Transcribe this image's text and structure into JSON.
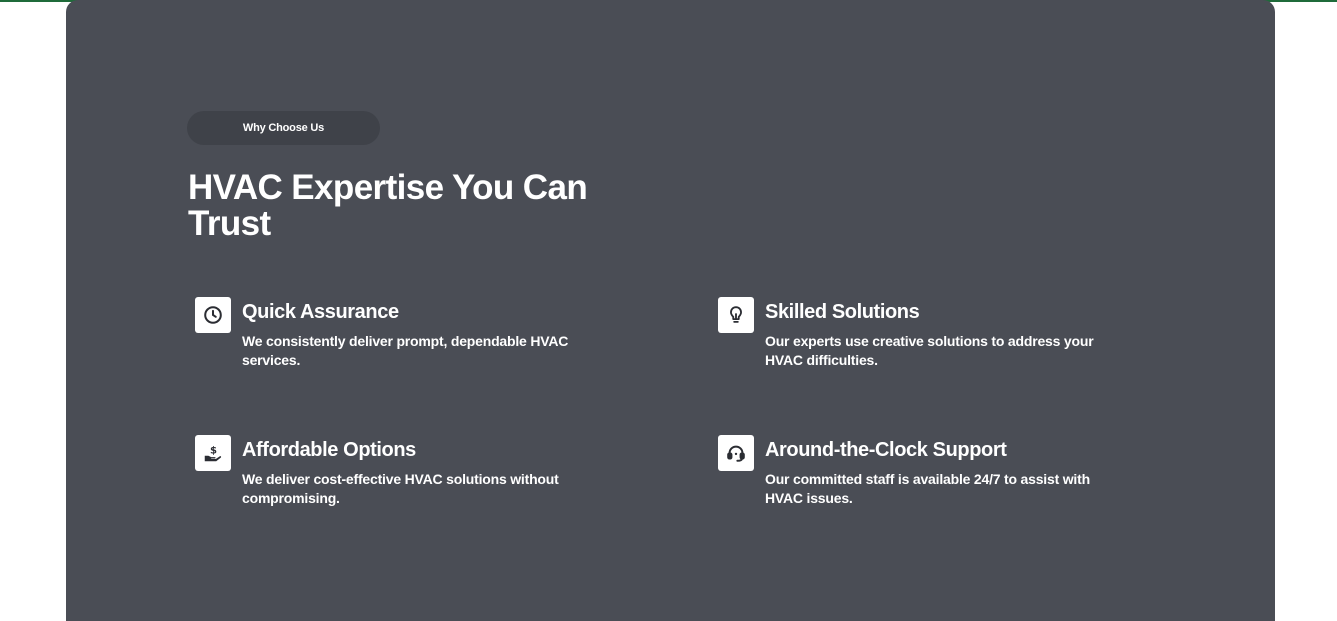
{
  "section": {
    "badge": "Why Choose Us",
    "heading": "HVAC Expertise You Can Trust"
  },
  "features": [
    {
      "icon": "clock-icon",
      "title": "Quick Assurance",
      "description": "We consistently deliver prompt, dependable HVAC services."
    },
    {
      "icon": "lightbulb-icon",
      "title": "Skilled Solutions",
      "description": "Our experts use creative solutions to address your HVAC difficulties."
    },
    {
      "icon": "hand-money-icon",
      "title": "Affordable Options",
      "description": "We deliver cost-effective HVAC solutions without compromising."
    },
    {
      "icon": "headset-icon",
      "title": "Around-the-Clock Support",
      "description": "Our committed staff is available 24/7 to assist with HVAC issues."
    }
  ],
  "colors": {
    "panel": "#4a4d55",
    "badge": "#3f4249",
    "accent_line": "#1f6b3a",
    "text": "#ffffff",
    "icon": "#2b2d33"
  }
}
